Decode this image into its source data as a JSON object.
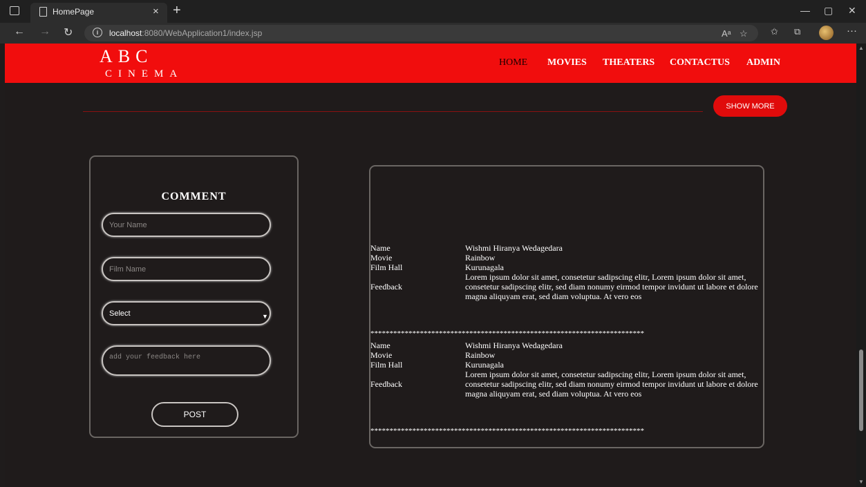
{
  "browser": {
    "tab_title": "HomePage",
    "tab_close": "×",
    "new_tab": "+",
    "url_host": "localhost",
    "url_rest": ":8080/WebApplication1/index.jsp",
    "read_aloud": "Aᵃ",
    "minimize": "—",
    "maximize": "▢",
    "close": "✕"
  },
  "site": {
    "logo_main": "ABC",
    "logo_sub": "CINEMA",
    "nav": [
      "HOME",
      "MOVIES",
      "THEATERS",
      "CONTACTUS",
      "ADMIN"
    ],
    "active_nav": "HOME",
    "show_more": "SHOW MORE",
    "brand_color": "#f10d0d"
  },
  "comment_form": {
    "title": "COMMENT",
    "name_placeholder": "Your Name",
    "film_placeholder": "Film Name",
    "select_value": "Select",
    "feedback_placeholder": "add your feedback here",
    "post_label": "POST"
  },
  "feedback_list": {
    "labels": {
      "name": "Name",
      "movie": "Movie",
      "hall": "Film Hall",
      "feedback": "Feedback"
    },
    "separator": "************************************************************************",
    "entries": [
      {
        "name": "Wishmi Hiranya Wedagedara",
        "movie": "Rainbow",
        "hall": "Kurunagala",
        "feedback": "Lorem ipsum dolor sit amet, consetetur sadipscing elitr, Lorem ipsum dolor sit amet, consetetur sadipscing elitr, sed diam nonumy eirmod tempor invidunt ut labore et dolore magna aliquyam erat, sed diam voluptua. At vero eos"
      },
      {
        "name": "Wishmi Hiranya Wedagedara",
        "movie": "Rainbow",
        "hall": "Kurunagala",
        "feedback": "Lorem ipsum dolor sit amet, consetetur sadipscing elitr, Lorem ipsum dolor sit amet, consetetur sadipscing elitr, sed diam nonumy eirmod tempor invidunt ut labore et dolore magna aliquyam erat, sed diam voluptua. At vero eos"
      }
    ]
  }
}
